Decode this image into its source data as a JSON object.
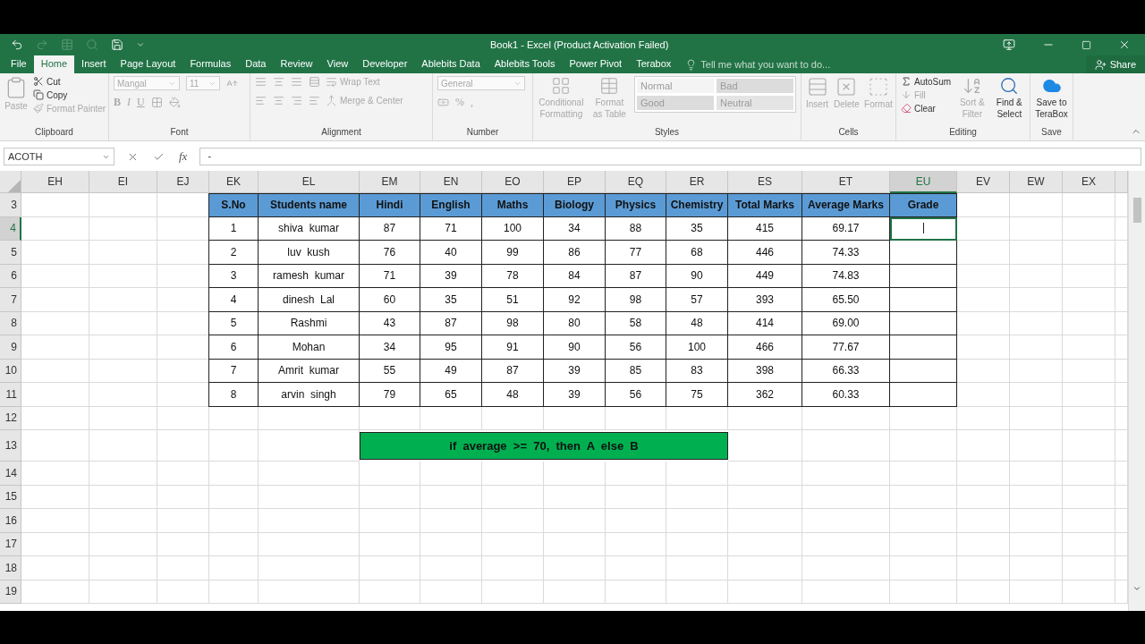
{
  "window": {
    "title": "Book1 - Excel (Product Activation Failed)"
  },
  "tabs": [
    {
      "label": "File",
      "selected": false
    },
    {
      "label": "Home",
      "selected": true
    },
    {
      "label": "Insert",
      "selected": false
    },
    {
      "label": "Page Layout",
      "selected": false
    },
    {
      "label": "Formulas",
      "selected": false
    },
    {
      "label": "Data",
      "selected": false
    },
    {
      "label": "Review",
      "selected": false
    },
    {
      "label": "View",
      "selected": false
    },
    {
      "label": "Developer",
      "selected": false
    },
    {
      "label": "Ablebits Data",
      "selected": false
    },
    {
      "label": "Ablebits Tools",
      "selected": false
    },
    {
      "label": "Power Pivot",
      "selected": false
    },
    {
      "label": "Terabox",
      "selected": false
    }
  ],
  "tell_me": {
    "placeholder": "Tell me what you want to do..."
  },
  "share": {
    "label": "Share"
  },
  "ribbon": {
    "clipboard": {
      "label": "Clipboard",
      "paste": {
        "label": "Paste",
        "disabled": true
      },
      "commands": [
        {
          "label": "Cut",
          "disabled": false
        },
        {
          "label": "Copy",
          "disabled": false
        },
        {
          "label": "Format Painter",
          "disabled": true
        }
      ]
    },
    "font": {
      "label": "Font",
      "name": "Mangal",
      "size": "11",
      "styles": [
        "B",
        "I",
        "U"
      ],
      "disabled": true
    },
    "alignment": {
      "label": "Alignment",
      "commands": [
        {
          "label": "Wrap Text",
          "disabled": true
        },
        {
          "label": "Merge & Center",
          "disabled": true
        }
      ]
    },
    "number": {
      "label": "Number",
      "format": "General",
      "symbols": [
        "%",
        ","
      ],
      "disabled": true
    },
    "styles": {
      "label": "Styles",
      "commands": [
        {
          "label": "Conditional Formatting",
          "disabled": true
        },
        {
          "label": "Format as Table",
          "disabled": true
        }
      ],
      "gallery": [
        {
          "label": "Normal",
          "color": "#f4f4f4"
        },
        {
          "label": "Bad",
          "color": "#dcdcdc"
        },
        {
          "label": "Good",
          "color": "#dcdcdc"
        },
        {
          "label": "Neutral",
          "color": "#e4e4e4"
        }
      ]
    },
    "cells": {
      "label": "Cells",
      "commands": [
        {
          "label": "Insert",
          "disabled": true
        },
        {
          "label": "Delete",
          "disabled": true
        },
        {
          "label": "Format",
          "disabled": true
        }
      ]
    },
    "editing": {
      "label": "Editing",
      "commands": [
        {
          "label": "AutoSum",
          "disabled": false
        },
        {
          "label": "Fill",
          "disabled": true
        },
        {
          "label": "Clear",
          "disabled": false
        },
        {
          "label": "Sort & Filter",
          "disabled": true
        },
        {
          "label": "Find & Select",
          "disabled": false
        }
      ]
    },
    "save": {
      "label": "Save",
      "commands": [
        {
          "label": "Save to TeraBox",
          "disabled": false
        }
      ]
    }
  },
  "formula_bar": {
    "name_box": "ACOTH",
    "function_label": "fx",
    "value": "-"
  },
  "columns": [
    {
      "label": "EH",
      "selected": false
    },
    {
      "label": "EI",
      "selected": false
    },
    {
      "label": "EJ",
      "selected": false
    },
    {
      "label": "EK",
      "selected": false
    },
    {
      "label": "EL",
      "selected": false
    },
    {
      "label": "EM",
      "selected": false
    },
    {
      "label": "EN",
      "selected": false
    },
    {
      "label": "EO",
      "selected": false
    },
    {
      "label": "EP",
      "selected": false
    },
    {
      "label": "EQ",
      "selected": false
    },
    {
      "label": "ER",
      "selected": false
    },
    {
      "label": "ES",
      "selected": false
    },
    {
      "label": "ET",
      "selected": false
    },
    {
      "label": "EU",
      "selected": true
    },
    {
      "label": "EV",
      "selected": false
    },
    {
      "label": "EW",
      "selected": false
    },
    {
      "label": "EX",
      "selected": false
    }
  ],
  "rows": [
    {
      "number": "3",
      "selected": false,
      "kind": "header",
      "cells": [
        "S.No",
        "Students name",
        "Hindi",
        "English",
        "Maths",
        "Biology",
        "Physics",
        "Chemistry",
        "Total Marks",
        "Average Marks",
        "Grade"
      ]
    },
    {
      "number": "4",
      "selected": true,
      "kind": "data",
      "cells": [
        "1",
        "shiva  kumar",
        "87",
        "71",
        "100",
        "34",
        "88",
        "35",
        "415",
        "69.17"
      ],
      "grade_selected": true
    },
    {
      "number": "5",
      "selected": false,
      "kind": "data",
      "cells": [
        "2",
        "luv  kush",
        "76",
        "40",
        "99",
        "86",
        "77",
        "68",
        "446",
        "74.33"
      ],
      "grade_selected": false
    },
    {
      "number": "6",
      "selected": false,
      "kind": "data",
      "cells": [
        "3",
        "ramesh  kumar",
        "71",
        "39",
        "78",
        "84",
        "87",
        "90",
        "449",
        "74.83"
      ],
      "grade_selected": false
    },
    {
      "number": "7",
      "selected": false,
      "kind": "data",
      "cells": [
        "4",
        "dinesh  Lal",
        "60",
        "35",
        "51",
        "92",
        "98",
        "57",
        "393",
        "65.50"
      ],
      "grade_selected": false
    },
    {
      "number": "8",
      "selected": false,
      "kind": "data",
      "cells": [
        "5",
        "Rashmi",
        "43",
        "87",
        "98",
        "80",
        "58",
        "48",
        "414",
        "69.00"
      ],
      "grade_selected": false
    },
    {
      "number": "9",
      "selected": false,
      "kind": "data",
      "cells": [
        "6",
        "Mohan",
        "34",
        "95",
        "91",
        "90",
        "56",
        "100",
        "466",
        "77.67"
      ],
      "grade_selected": false
    },
    {
      "number": "10",
      "selected": false,
      "kind": "data",
      "cells": [
        "7",
        "Amrit  kumar",
        "55",
        "49",
        "87",
        "39",
        "85",
        "83",
        "398",
        "66.33"
      ],
      "grade_selected": false
    },
    {
      "number": "11",
      "selected": false,
      "kind": "data",
      "cells": [
        "8",
        "arvin  singh",
        "79",
        "65",
        "48",
        "39",
        "56",
        "75",
        "362",
        "60.33"
      ],
      "grade_selected": false
    },
    {
      "number": "12",
      "selected": false,
      "kind": "blank"
    },
    {
      "number": "13",
      "selected": false,
      "kind": "note",
      "text": "if  average  >=  70,  then  A  else  B"
    },
    {
      "number": "14",
      "selected": false,
      "kind": "blank"
    },
    {
      "number": "15",
      "selected": false,
      "kind": "blank"
    },
    {
      "number": "16",
      "selected": false,
      "kind": "blank"
    },
    {
      "number": "17",
      "selected": false,
      "kind": "blank"
    },
    {
      "number": "18",
      "selected": false,
      "kind": "blank"
    },
    {
      "number": "19",
      "selected": false,
      "kind": "blank"
    }
  ]
}
